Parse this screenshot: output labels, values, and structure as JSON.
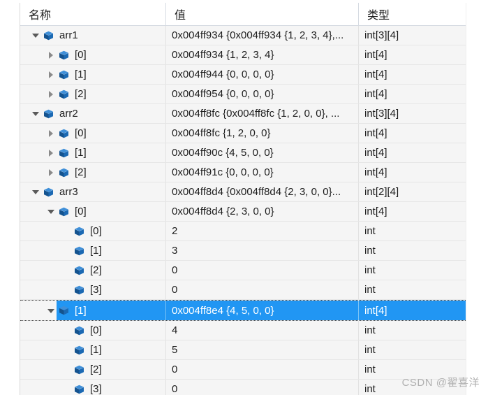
{
  "window": {
    "kind": "debugger-variables-grid",
    "selected_row_index": 15
  },
  "columns": {
    "name": "名称",
    "value": "值",
    "type": "类型"
  },
  "theme": {
    "selection_color": "#2196f3",
    "header_background": "#ffffff",
    "row_background": "#f5f5f5",
    "grid_line": "#e6e6e6",
    "text_color": "#1e1e1e",
    "cube_icon_color": "#1f6fc4"
  },
  "rows": [
    {
      "depth": 0,
      "expander": "expanded",
      "name": "arr1",
      "value": "0x004ff934 {0x004ff934 {1, 2, 3, 4},...",
      "type": "int[3][4]",
      "selected": false
    },
    {
      "depth": 1,
      "expander": "collapsed",
      "name": "[0]",
      "value": "0x004ff934 {1, 2, 3, 4}",
      "type": "int[4]",
      "selected": false
    },
    {
      "depth": 1,
      "expander": "collapsed",
      "name": "[1]",
      "value": "0x004ff944 {0, 0, 0, 0}",
      "type": "int[4]",
      "selected": false
    },
    {
      "depth": 1,
      "expander": "collapsed",
      "name": "[2]",
      "value": "0x004ff954 {0, 0, 0, 0}",
      "type": "int[4]",
      "selected": false
    },
    {
      "depth": 0,
      "expander": "expanded",
      "name": "arr2",
      "value": "0x004ff8fc {0x004ff8fc {1, 2, 0, 0}, ...",
      "type": "int[3][4]",
      "selected": false
    },
    {
      "depth": 1,
      "expander": "collapsed",
      "name": "[0]",
      "value": "0x004ff8fc {1, 2, 0, 0}",
      "type": "int[4]",
      "selected": false
    },
    {
      "depth": 1,
      "expander": "collapsed",
      "name": "[1]",
      "value": "0x004ff90c {4, 5, 0, 0}",
      "type": "int[4]",
      "selected": false
    },
    {
      "depth": 1,
      "expander": "collapsed",
      "name": "[2]",
      "value": "0x004ff91c {0, 0, 0, 0}",
      "type": "int[4]",
      "selected": false
    },
    {
      "depth": 0,
      "expander": "expanded",
      "name": "arr3",
      "value": "0x004ff8d4 {0x004ff8d4 {2, 3, 0, 0}...",
      "type": "int[2][4]",
      "selected": false
    },
    {
      "depth": 1,
      "expander": "expanded",
      "name": "[0]",
      "value": "0x004ff8d4 {2, 3, 0, 0}",
      "type": "int[4]",
      "selected": false
    },
    {
      "depth": 2,
      "expander": "leaf",
      "name": "[0]",
      "value": "2",
      "type": "int",
      "selected": false
    },
    {
      "depth": 2,
      "expander": "leaf",
      "name": "[1]",
      "value": "3",
      "type": "int",
      "selected": false
    },
    {
      "depth": 2,
      "expander": "leaf",
      "name": "[2]",
      "value": "0",
      "type": "int",
      "selected": false
    },
    {
      "depth": 2,
      "expander": "leaf",
      "name": "[3]",
      "value": "0",
      "type": "int",
      "selected": false
    },
    {
      "depth": 1,
      "expander": "expanded",
      "name": "[1]",
      "value": "0x004ff8e4 {4, 5, 0, 0}",
      "type": "int[4]",
      "selected": true
    },
    {
      "depth": 2,
      "expander": "leaf",
      "name": "[0]",
      "value": "4",
      "type": "int",
      "selected": false
    },
    {
      "depth": 2,
      "expander": "leaf",
      "name": "[1]",
      "value": "5",
      "type": "int",
      "selected": false
    },
    {
      "depth": 2,
      "expander": "leaf",
      "name": "[2]",
      "value": "0",
      "type": "int",
      "selected": false
    },
    {
      "depth": 2,
      "expander": "leaf",
      "name": "[3]",
      "value": "0",
      "type": "int",
      "selected": false
    }
  ],
  "watermark": {
    "text": "CSDN @翟喜洋"
  }
}
